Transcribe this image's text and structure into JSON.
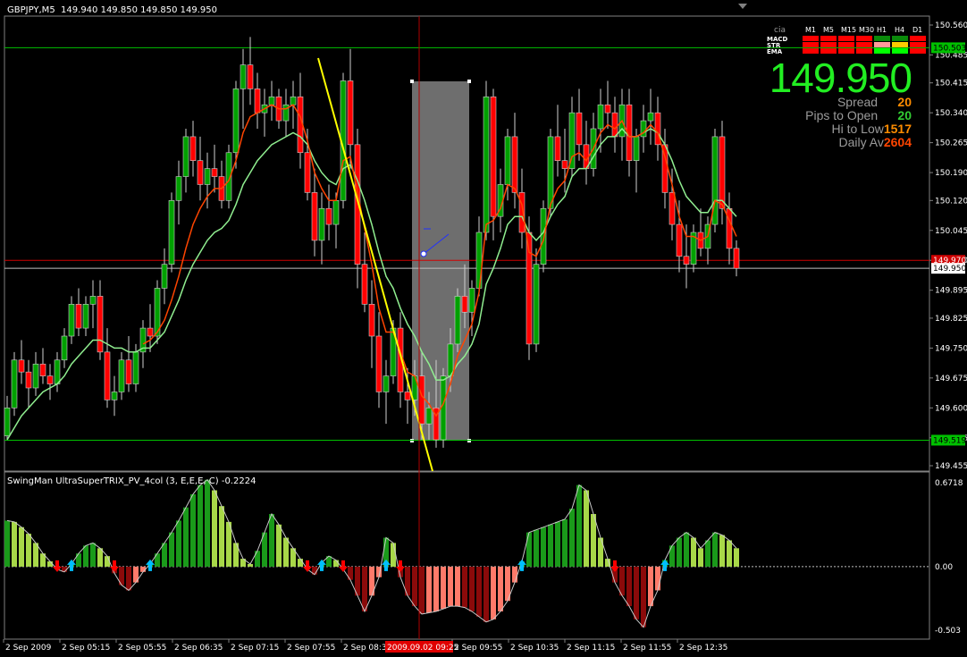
{
  "header": {
    "symbol_label": "GBPJPY,M5",
    "ohlc": "149.940 149.850 149.850 149.950"
  },
  "indicator_header": {
    "label": "SwingMan UltraSuperTRIX_PV_4col (3, E,E,E, C) -0.2224"
  },
  "dashboard": {
    "corner_label": "cia",
    "timeframes": [
      "M1",
      "M5",
      "M15",
      "M30",
      "H1",
      "H4",
      "D1"
    ],
    "rows": [
      {
        "name": "MACD",
        "colors": [
          "#ff0000",
          "#ff0000",
          "#ff0000",
          "#ff0000",
          "#0a8a0a",
          "#0a8a0a",
          "#ff0000"
        ]
      },
      {
        "name": "STR",
        "colors": [
          "#ff0000",
          "#ff0000",
          "#ff0000",
          "#ff0000",
          "#ff9a9a",
          "#ffcc00",
          "#ff0000"
        ]
      },
      {
        "name": "EMA",
        "colors": [
          "#ff0000",
          "#ff0000",
          "#ff0000",
          "#ff0000",
          "#00ff00",
          "#00ff00",
          "#ff0000"
        ]
      }
    ]
  },
  "info": {
    "price": "149.950",
    "spread_label": "Spread",
    "spread_value": "20",
    "pips_label": "Pips to Open",
    "pips_value": "20",
    "hilo_label": "Hi to Low",
    "hilo_value": "1517",
    "daily_label": "Daily Av",
    "daily_value": "2604",
    "colors": {
      "price": "#22ee22",
      "spread": "#ff8c00",
      "pips": "#33cc33",
      "hilo": "#ff8c00",
      "daily": "#ff4500"
    }
  },
  "price_axis": {
    "ticks": [
      "150.560",
      "150.485",
      "150.415",
      "150.340",
      "150.265",
      "150.190",
      "150.120",
      "150.045",
      "149.970",
      "149.895",
      "149.825",
      "149.750",
      "149.675",
      "149.600",
      "149.525",
      "149.455"
    ],
    "tick_values": [
      150.56,
      150.485,
      150.415,
      150.34,
      150.265,
      150.19,
      150.12,
      150.045,
      149.97,
      149.895,
      149.825,
      149.75,
      149.675,
      149.6,
      149.525,
      149.455
    ],
    "range": [
      149.455,
      150.56
    ],
    "levels": [
      {
        "label": "150.503",
        "value": 150.503,
        "color": "#00c000",
        "line": "#00c000"
      },
      {
        "label": "149.970",
        "value": 149.97,
        "color": "#d00000",
        "line": "#d00000"
      },
      {
        "label": "149.950",
        "value": 149.95,
        "color": "#ffffff",
        "line": "#c0c0c0"
      },
      {
        "label": "149.519",
        "value": 149.519,
        "color": "#00c000",
        "line": "#00c000"
      }
    ]
  },
  "indicator_axis": {
    "max_label": "0.6718",
    "zero_label": "0.00",
    "min_label": "-0.503",
    "range": [
      -0.503,
      0.6718
    ]
  },
  "time_axis": {
    "labels": [
      "2 Sep 2009",
      "2 Sep 05:15",
      "2 Sep 05:55",
      "2 Sep 06:35",
      "2 Sep 07:15",
      "2 Sep 07:55",
      "2 Sep 08:35",
      "2 Sep 09:55",
      "2 Sep 10:35",
      "2 Sep 11:15",
      "2 Sep 11:55",
      "2 Sep 12:35"
    ],
    "cursor_label": "2009.09.02 09:25"
  },
  "chart_data": {
    "type": "candlestick",
    "symbol": "GBPJPY",
    "timeframe": "M5",
    "ylim": [
      149.455,
      150.56
    ],
    "colors": {
      "bull": "#00a000",
      "bear": "#ff0000",
      "ma_fast": "#ff4500",
      "ma_slow": "#90ee90"
    },
    "candles": [
      [
        149.53,
        149.63,
        149.52,
        149.6
      ],
      [
        149.6,
        149.74,
        149.58,
        149.72
      ],
      [
        149.72,
        149.77,
        149.66,
        149.69
      ],
      [
        149.69,
        149.72,
        149.6,
        149.65
      ],
      [
        149.65,
        149.74,
        149.63,
        149.71
      ],
      [
        149.71,
        149.75,
        149.66,
        149.68
      ],
      [
        149.68,
        149.71,
        149.62,
        149.66
      ],
      [
        149.66,
        149.74,
        149.64,
        149.72
      ],
      [
        149.72,
        149.8,
        149.7,
        149.78
      ],
      [
        149.78,
        149.88,
        149.76,
        149.86
      ],
      [
        149.86,
        149.9,
        149.78,
        149.8
      ],
      [
        149.8,
        149.88,
        149.78,
        149.86
      ],
      [
        149.86,
        149.92,
        149.8,
        149.88
      ],
      [
        149.88,
        149.92,
        149.72,
        149.74
      ],
      [
        149.74,
        149.8,
        149.6,
        149.62
      ],
      [
        149.62,
        149.68,
        149.58,
        149.64
      ],
      [
        149.64,
        149.74,
        149.62,
        149.72
      ],
      [
        149.72,
        149.78,
        149.64,
        149.66
      ],
      [
        149.66,
        149.76,
        149.64,
        149.74
      ],
      [
        149.74,
        149.82,
        149.7,
        149.8
      ],
      [
        149.8,
        149.86,
        149.74,
        149.78
      ],
      [
        149.78,
        149.92,
        149.76,
        149.9
      ],
      [
        149.9,
        150.0,
        149.86,
        149.96
      ],
      [
        149.96,
        150.14,
        149.94,
        150.12
      ],
      [
        150.12,
        150.22,
        150.06,
        150.18
      ],
      [
        150.18,
        150.3,
        150.14,
        150.28
      ],
      [
        150.28,
        150.32,
        150.18,
        150.22
      ],
      [
        150.22,
        150.28,
        150.12,
        150.16
      ],
      [
        150.16,
        150.24,
        150.1,
        150.2
      ],
      [
        150.2,
        150.26,
        150.14,
        150.18
      ],
      [
        150.18,
        150.22,
        150.1,
        150.12
      ],
      [
        150.12,
        150.26,
        150.1,
        150.24
      ],
      [
        150.24,
        150.42,
        150.2,
        150.4
      ],
      [
        150.4,
        150.5,
        150.3,
        150.46
      ],
      [
        150.46,
        150.53,
        150.36,
        150.4
      ],
      [
        150.4,
        150.44,
        150.3,
        150.34
      ],
      [
        150.34,
        150.4,
        150.28,
        150.36
      ],
      [
        150.36,
        150.42,
        150.32,
        150.38
      ],
      [
        150.38,
        150.4,
        150.3,
        150.32
      ],
      [
        150.32,
        150.4,
        150.28,
        150.36
      ],
      [
        150.36,
        150.42,
        150.3,
        150.38
      ],
      [
        150.38,
        150.44,
        150.2,
        150.24
      ],
      [
        150.24,
        150.3,
        150.12,
        150.14
      ],
      [
        150.14,
        150.2,
        149.98,
        150.02
      ],
      [
        150.02,
        150.14,
        149.96,
        150.1
      ],
      [
        150.1,
        150.16,
        150.02,
        150.06
      ],
      [
        150.06,
        150.14,
        150.0,
        150.12
      ],
      [
        150.12,
        150.44,
        150.1,
        150.42
      ],
      [
        150.42,
        150.5,
        150.2,
        150.26
      ],
      [
        150.26,
        150.3,
        149.9,
        149.96
      ],
      [
        149.96,
        150.04,
        149.84,
        149.86
      ],
      [
        149.86,
        149.92,
        149.7,
        149.78
      ],
      [
        149.78,
        149.84,
        149.6,
        149.64
      ],
      [
        149.64,
        149.72,
        149.56,
        149.68
      ],
      [
        149.68,
        149.82,
        149.66,
        149.8
      ],
      [
        149.8,
        149.84,
        149.6,
        149.64
      ],
      [
        149.64,
        149.7,
        149.56,
        149.62
      ],
      [
        149.62,
        149.72,
        149.58,
        149.68
      ],
      [
        149.68,
        149.74,
        149.52,
        149.56
      ],
      [
        149.56,
        149.64,
        149.52,
        149.6
      ],
      [
        149.6,
        149.72,
        149.5,
        149.52
      ],
      [
        149.52,
        149.7,
        149.5,
        149.68
      ],
      [
        149.68,
        149.8,
        149.64,
        149.76
      ],
      [
        149.76,
        149.9,
        149.74,
        149.88
      ],
      [
        149.88,
        149.96,
        149.8,
        149.84
      ],
      [
        149.84,
        149.92,
        149.78,
        149.9
      ],
      [
        149.9,
        150.08,
        149.88,
        150.04
      ],
      [
        150.04,
        150.42,
        150.02,
        150.38
      ],
      [
        150.38,
        150.4,
        150.02,
        150.08
      ],
      [
        150.08,
        150.2,
        150.04,
        150.16
      ],
      [
        150.16,
        150.3,
        150.12,
        150.28
      ],
      [
        150.28,
        150.34,
        150.1,
        150.14
      ],
      [
        150.14,
        150.2,
        150.0,
        150.04
      ],
      [
        150.04,
        150.08,
        149.72,
        149.76
      ],
      [
        149.76,
        150.0,
        149.74,
        149.96
      ],
      [
        149.96,
        150.12,
        149.94,
        150.1
      ],
      [
        150.1,
        150.3,
        150.08,
        150.28
      ],
      [
        150.28,
        150.36,
        150.18,
        150.22
      ],
      [
        150.22,
        150.3,
        150.14,
        150.2
      ],
      [
        150.2,
        150.38,
        150.18,
        150.34
      ],
      [
        150.34,
        150.4,
        150.22,
        150.26
      ],
      [
        150.26,
        150.32,
        150.16,
        150.2
      ],
      [
        150.2,
        150.34,
        150.18,
        150.3
      ],
      [
        150.3,
        150.4,
        150.24,
        150.36
      ],
      [
        150.36,
        150.42,
        150.3,
        150.34
      ],
      [
        150.34,
        150.38,
        150.24,
        150.28
      ],
      [
        150.28,
        150.4,
        150.22,
        150.36
      ],
      [
        150.36,
        150.4,
        150.18,
        150.22
      ],
      [
        150.22,
        150.3,
        150.14,
        150.28
      ],
      [
        150.28,
        150.36,
        150.24,
        150.32
      ],
      [
        150.32,
        150.4,
        150.26,
        150.34
      ],
      [
        150.34,
        150.38,
        150.22,
        150.26
      ],
      [
        150.26,
        150.3,
        150.1,
        150.14
      ],
      [
        150.14,
        150.2,
        150.02,
        150.06
      ],
      [
        150.06,
        150.12,
        149.94,
        149.98
      ],
      [
        149.98,
        150.06,
        149.9,
        149.96
      ],
      [
        149.96,
        150.06,
        149.94,
        150.04
      ],
      [
        150.04,
        150.1,
        149.98,
        150.0
      ],
      [
        150.0,
        150.08,
        149.96,
        150.06
      ],
      [
        150.06,
        150.3,
        150.04,
        150.28
      ],
      [
        150.28,
        150.32,
        150.06,
        150.1
      ],
      [
        150.1,
        150.14,
        149.96,
        150.0
      ],
      [
        150.0,
        150.02,
        149.93,
        149.95
      ]
    ],
    "ma_fast": [
      null,
      null,
      null,
      null,
      null,
      null,
      null,
      null,
      null,
      null,
      null,
      null,
      null,
      null,
      null,
      null,
      null,
      null,
      null,
      149.76,
      149.77,
      149.79,
      149.82,
      149.87,
      149.93,
      150.0,
      150.06,
      150.1,
      150.13,
      150.15,
      150.15,
      150.17,
      150.22,
      150.29,
      150.33,
      150.34,
      150.35,
      150.36,
      150.35,
      150.35,
      150.36,
      150.33,
      150.27,
      150.19,
      150.15,
      150.12,
      150.12,
      150.22,
      150.23,
      150.14,
      150.05,
      149.96,
      149.85,
      149.79,
      149.79,
      149.74,
      149.69,
      149.68,
      149.63,
      149.61,
      149.58,
      149.61,
      149.66,
      149.73,
      149.77,
      149.81,
      149.89,
      150.06,
      150.07,
      150.1,
      150.16,
      150.15,
      150.11,
      149.99,
      149.98,
      150.02,
      150.11,
      150.15,
      150.17,
      150.23,
      150.24,
      150.22,
      150.25,
      150.29,
      150.31,
      150.3,
      150.32,
      150.28,
      150.28,
      150.29,
      150.31,
      150.29,
      150.23,
      150.16,
      150.08,
      150.03,
      150.03,
      150.02,
      150.03,
      150.12,
      150.11,
      150.07,
      150.03
    ],
    "ma_slow": [
      149.52,
      149.55,
      149.58,
      149.6,
      149.62,
      149.64,
      149.65,
      149.66,
      149.68,
      149.71,
      149.73,
      149.75,
      149.77,
      149.77,
      149.76,
      149.75,
      149.75,
      149.74,
      149.74,
      149.75,
      149.75,
      149.77,
      149.79,
      149.83,
      149.87,
      149.92,
      149.96,
      149.99,
      150.02,
      150.04,
      150.05,
      150.07,
      150.11,
      150.16,
      150.19,
      150.22,
      150.24,
      150.26,
      150.27,
      150.28,
      150.29,
      150.28,
      150.26,
      150.22,
      150.19,
      150.17,
      150.16,
      150.2,
      150.21,
      150.17,
      150.12,
      150.06,
      149.99,
      149.93,
      149.9,
      149.85,
      149.81,
      149.78,
      149.74,
      149.71,
      149.67,
      149.67,
      149.68,
      149.71,
      149.73,
      149.76,
      149.81,
      149.91,
      149.95,
      150.0,
      150.06,
      150.08,
      150.08,
      150.04,
      150.02,
      150.04,
      150.08,
      150.11,
      150.13,
      150.18,
      150.2,
      150.2,
      150.23,
      150.26,
      150.28,
      150.28,
      150.3,
      150.28,
      150.28,
      150.29,
      150.3,
      150.29,
      150.26,
      150.22,
      150.17,
      150.13,
      150.11,
      150.09,
      150.09,
      150.12,
      150.12,
      150.1,
      150.08
    ],
    "indicator": [
      0.35,
      0.34,
      0.3,
      0.25,
      0.18,
      0.1,
      0.04,
      -0.02,
      -0.04,
      0.02,
      0.1,
      0.16,
      0.18,
      0.14,
      0.08,
      -0.05,
      -0.14,
      -0.18,
      -0.12,
      -0.04,
      0.02,
      0.1,
      0.18,
      0.26,
      0.35,
      0.45,
      0.55,
      0.62,
      0.66,
      0.58,
      0.46,
      0.34,
      0.18,
      0.06,
      0.02,
      0.12,
      0.26,
      0.4,
      0.32,
      0.22,
      0.14,
      0.06,
      -0.02,
      -0.06,
      0.03,
      0.08,
      0.05,
      -0.02,
      -0.1,
      -0.22,
      -0.34,
      -0.22,
      -0.08,
      0.22,
      0.18,
      -0.08,
      -0.22,
      -0.3,
      -0.36,
      -0.35,
      -0.34,
      -0.32,
      -0.3,
      -0.3,
      -0.31,
      -0.34,
      -0.38,
      -0.42,
      -0.4,
      -0.34,
      -0.26,
      -0.12,
      0.04,
      0.26,
      0.28,
      0.3,
      0.32,
      0.34,
      0.36,
      0.44,
      0.62,
      0.58,
      0.4,
      0.22,
      0.06,
      -0.12,
      -0.22,
      -0.3,
      -0.4,
      -0.46,
      -0.3,
      -0.18,
      0.05,
      0.16,
      0.22,
      0.26,
      0.22,
      0.14,
      0.2,
      0.26,
      0.24,
      0.2,
      0.14
    ],
    "vertical_cursor_index": 61
  }
}
